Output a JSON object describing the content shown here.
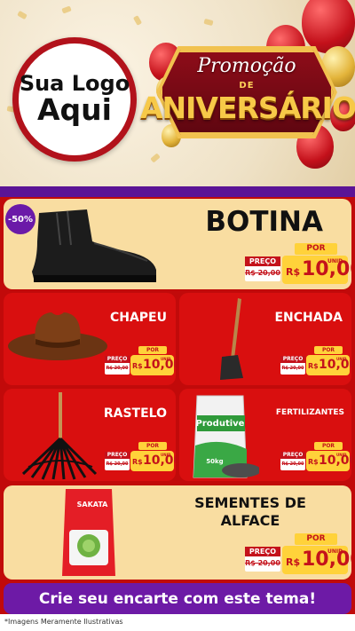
{
  "header": {
    "logo_line1": "Sua Logo",
    "logo_line2": "Aqui",
    "promo_line1": "Promoção",
    "promo_line2": "DE",
    "promo_line3": "ANIVERSÁRIO"
  },
  "colors": {
    "background_red": "#c10a0a",
    "card_red": "#d90f0f",
    "card_cream": "#f9dda1",
    "purple": "#6d1aa6",
    "price_yellow": "#ffd23a"
  },
  "products": {
    "botina": {
      "name": "BOTINA",
      "discount": "-50%",
      "por": "POR",
      "preco_label": "PREÇO",
      "old_price": "R$ 20,00",
      "currency": "R$",
      "price": "10,00",
      "unit": "UNID",
      "icon": "boot-icon"
    },
    "chapeu": {
      "name": "CHAPEU",
      "por": "POR",
      "preco_label": "PREÇO",
      "old_price": "R$ 20,00",
      "currency": "R$",
      "price": "10,00",
      "unit": "UNID",
      "icon": "hat-icon"
    },
    "enchada": {
      "name": "ENCHADA",
      "por": "POR",
      "preco_label": "PREÇO",
      "old_price": "R$ 20,00",
      "currency": "R$",
      "price": "10,00",
      "unit": "UNID",
      "icon": "hoe-icon"
    },
    "rastelo": {
      "name": "RASTELO",
      "por": "POR",
      "preco_label": "PREÇO",
      "old_price": "R$ 20,00",
      "currency": "R$",
      "price": "10,00",
      "unit": "UNID",
      "icon": "rake-icon"
    },
    "fertilizantes": {
      "name": "FERTILIZANTES",
      "por": "POR",
      "preco_label": "PREÇO",
      "old_price": "R$ 20,00",
      "currency": "R$",
      "price": "10,00",
      "unit": "UNID",
      "icon": "fertilizer-bag-icon",
      "bag_brand": "Produtive",
      "bag_weight": "50kg"
    },
    "sementes": {
      "name_line1": "SEMENTES DE",
      "name_line2": "ALFACE",
      "por": "POR",
      "preco_label": "PREÇO",
      "old_price": "R$ 20,00",
      "currency": "R$",
      "price": "10,00",
      "unit": "UNID",
      "icon": "seed-packet-icon",
      "packet_brand": "SAKATA"
    }
  },
  "cta": {
    "label": "Crie seu encarte com este tema!"
  },
  "footer": {
    "note": "*Imagens Meramente Ilustrativas"
  }
}
